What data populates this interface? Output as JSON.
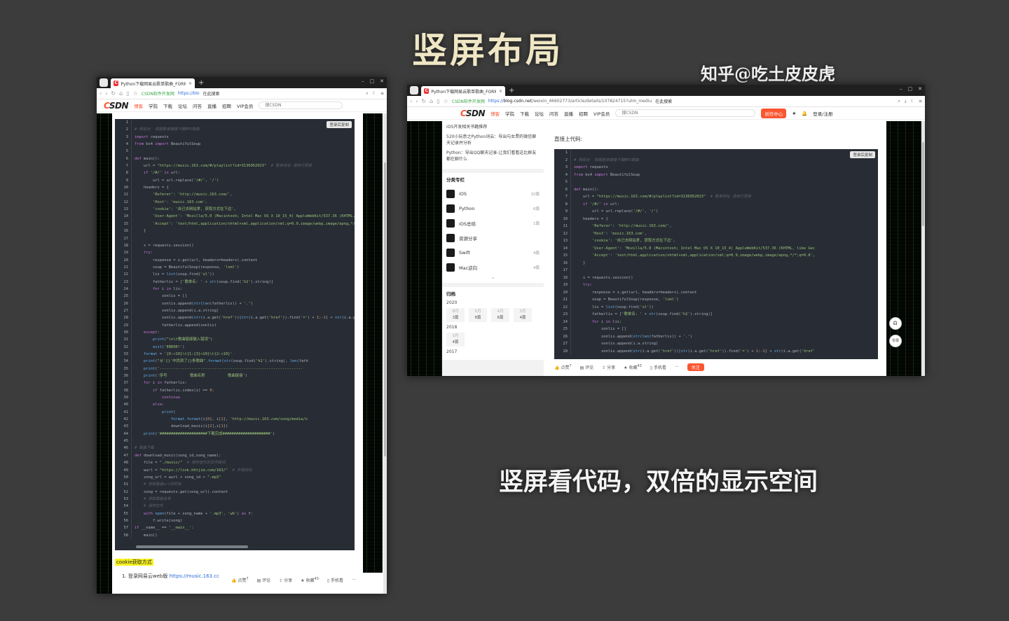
{
  "poster": {
    "title": "竖屏布局",
    "watermark": "知乎@吃土皮皮虎",
    "slogan": "竖屏看代码，双倍的显示空间"
  },
  "colors": {
    "accent": "#fc5531",
    "code_bg": "#282c34",
    "poster_bg": "#3c3c3c"
  },
  "browser_portrait": {
    "tab_title": "Python下载网易云歌单歌曲_FORM...",
    "tab_close": "×",
    "new_tab": "+",
    "site_name": "CSDN软件开发网",
    "url": "https://blo",
    "search_label": "在此搜索"
  },
  "browser_landscape": {
    "tab_title": "Python下载网易云歌单歌曲_FORM...",
    "tab_close": "×",
    "new_tab": "+",
    "site_name": "CSDN软件开发网",
    "url_scheme": "https://",
    "url_host": "blog.csdn.net",
    "url_path": "/weixin_46602773/article/details/107824715?utm_mediu",
    "search_label": "在此搜索"
  },
  "csdn_nav": {
    "logo_c": "C",
    "logo_rest": "SDN",
    "items": [
      "博客",
      "学院",
      "下载",
      "论坛",
      "问答",
      "直播",
      "招聘",
      "VIP会员"
    ],
    "search_placeholder": "搜CSDN",
    "create_button": "创作中心",
    "login": "登录/注册"
  },
  "code": {
    "copy_label": "登录后复制",
    "lines": [
      "1|",
      "2|# 网易云  根据歌单链接下载MP3歌曲",
      "3|import requests",
      "4|from bs4 import BeautifulSoup",
      "5|",
      "6|def main():",
      "7|    url = \"https://music.163.com/#/playlist?id=3136952023\"  # 歌单地址 请自行更换",
      "8|    if '/#/' in url:",
      "9|        url = url.replace('/#/', '/')",
      "10|    headers = {",
      "11|        'Referer': 'http://music.163.com/',",
      "12|        'Host': 'music.163.com',",
      "13|        'cookie': '自己去网站拿, 获取方式在下边',",
      "14|        'User-Agent': 'Mozilla/5.0 (Macintosh; Intel Mac OS X 10_15_4) AppleWebKit/537.36 (KHTML, like Gec",
      "15|        'Accept': 'text/html,application/xhtml+xml,application/xml;q=0.9,image/webp,image/apng,*/*;q=0.8',",
      "16|    }",
      "17|",
      "18|    s = requests.session()",
      "19|    try:",
      "20|        response = s.get(url, headers=headers).content",
      "21|        soup = BeautifulSoup(response, 'lxml')",
      "22|        lis = list(soup.find('ul'))",
      "23|        fatherlis = ['歌单名: ' + str(soup.find('h2').string)]",
      "24|        for i in lis:",
      "25|            sonlis = []",
      "26|            sonlis.append(str(len(fatherlis)) + '.')",
      "27|            sonlis.append(i.a.string)",
      "28|            sonlis.append(str(i.a.get('href'))[str(i.a.get('href')).find('=') + 1:-1] + str(i.a.get('href'",
      "29|            fatherlis.append(sonlis)",
      "30|    except:",
      "31|        print(\"\\n\\t歌曲链接输入错误\")",
      "32|        exit('ERROR!')",
      "33|    format = '{0:<10}\\t{1:{3}<10}\\t{2:<10}'",
      "34|    print(\"从'{}'中找到了{}条歌曲\".format(str(soup.find('h2').string), len(fath",
      "35|    print('---------------------------------------------------------------",
      "36|    print('序号          歌曲名称          歌曲链接')",
      "37|    for i in fatherlis:",
      "38|        if fatherlis.index(i) == 0:",
      "39|            continue",
      "40|        else:",
      "41|            print(",
      "42|                format.format(i[0], i[1], 'http://music.163.com/song/media/o",
      "43|                download_music(i[2],i[1])",
      "44|    print('#####################下载完成#####################')",
      "45|",
      "46|# 歌曲下载",
      "47|def download_music(song_id,song_name):",
      "48|    file = \"./music/\"  # 保存音乐的文件路径",
      "49|    wurl = \"https://link.hhtjim.com/163/\"  # 外链地址",
      "50|    song_url = wurl + song_id + \".mp3\"",
      "51|    # 获取歌曲url的时刻",
      "52|    song = requests.get(song_url).content",
      "53|    # 获取歌曲名称",
      "54|    # 保存文件",
      "55|    with open(file + song_name + '.mp3', 'wb') as f:",
      "56|        f.write(song)",
      "57|if __name__ == '__main__':",
      "58|    main()"
    ]
  },
  "article": {
    "cookie_heading": "cookie获取方式",
    "cookie_step_text": "1. 登录网易云web版",
    "cookie_step_link": "https://music.163.cc",
    "intro": "直接上代码:"
  },
  "bottom_toolbar": {
    "like": "点赞",
    "like_count": "7",
    "comment": "评论",
    "share": "分享",
    "favorite": "收藏",
    "favorite_count": "43",
    "mobile": "手机看",
    "more": "···",
    "follow": "关注"
  },
  "sidebar": {
    "recommend": [
      "iOS开发相关书籍推荐",
      "520小玩意之Python词云：导出与女票的微信聊天记录并分析",
      "Python：导出QQ聊天记录-让我们看看这比群友都在聊什么"
    ],
    "categories_title": "分类专栏",
    "categories": [
      {
        "name": "iOS",
        "count": "10篇"
      },
      {
        "name": "Python",
        "count": "6篇"
      },
      {
        "name": "iOS总结",
        "count": "1篇"
      },
      {
        "name": "资源分享",
        "count": ""
      },
      {
        "name": "Swift",
        "count": "4篇"
      },
      {
        "name": "Mac逆向",
        "count": "4篇"
      }
    ],
    "archive_title": "归档",
    "archive": [
      {
        "year": "2020",
        "months": [
          {
            "m": "8月",
            "c": "3篇"
          },
          {
            "m": "5月",
            "c": "8篇"
          },
          {
            "m": "4月",
            "c": "6篇"
          },
          {
            "m": "3月",
            "c": "4篇"
          }
        ]
      },
      {
        "year": "2018",
        "months": [
          {
            "m": "3月",
            "c": "4篇"
          }
        ]
      },
      {
        "year": "2017",
        "months": []
      }
    ]
  },
  "float_buttons": {
    "report": "举报"
  }
}
